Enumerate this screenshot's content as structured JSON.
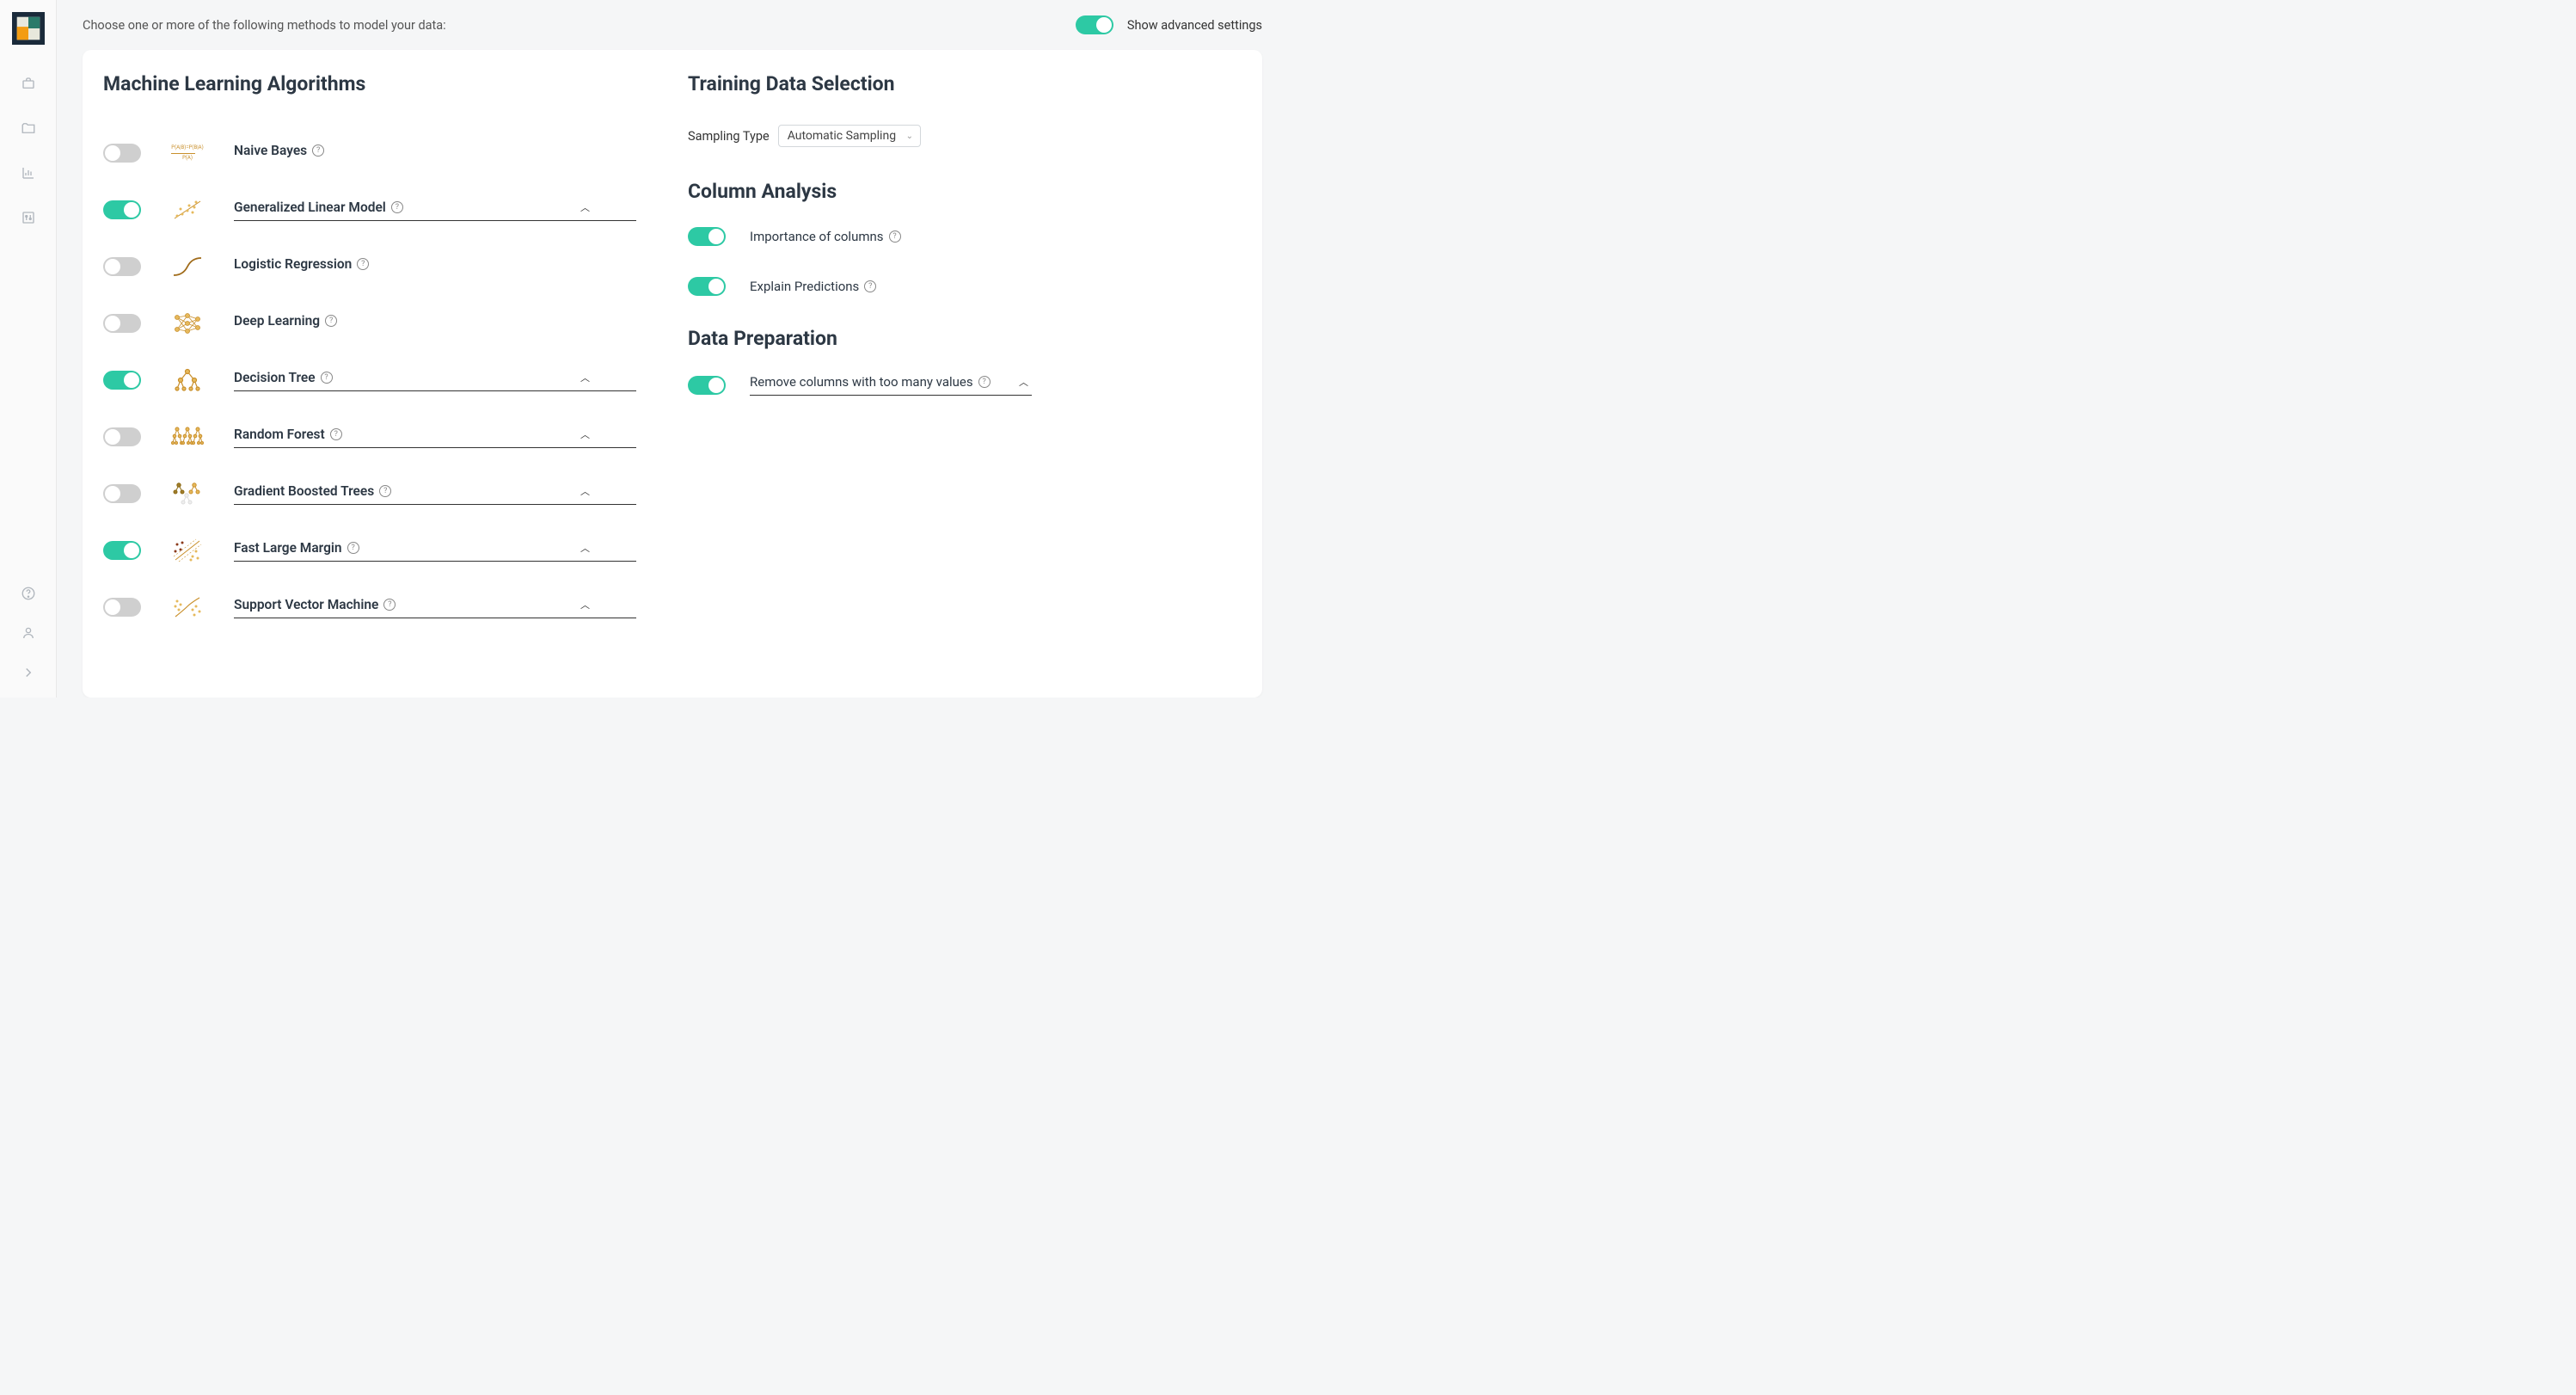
{
  "header": {
    "prompt": "Choose one or more of the following methods to model your data:",
    "advanced_label": "Show advanced settings",
    "advanced_on": true
  },
  "sections": {
    "algorithms_heading": "Machine Learning Algorithms",
    "training_heading": "Training Data Selection",
    "column_heading": "Column Analysis",
    "prep_heading": "Data Preparation"
  },
  "sampling": {
    "label": "Sampling Type",
    "value": "Automatic Sampling"
  },
  "column_analysis": {
    "importance_label": "Importance of columns",
    "importance_on": true,
    "explain_label": "Explain Predictions",
    "explain_on": true
  },
  "data_prep": {
    "remove_label": "Remove columns with too many values",
    "remove_on": true
  },
  "algorithms": [
    {
      "id": "naive-bayes",
      "label": "Naive Bayes",
      "on": false,
      "expandable": false
    },
    {
      "id": "glm",
      "label": "Generalized Linear Model",
      "on": true,
      "expandable": true
    },
    {
      "id": "logistic",
      "label": "Logistic Regression",
      "on": false,
      "expandable": false
    },
    {
      "id": "deep-learning",
      "label": "Deep Learning",
      "on": false,
      "expandable": false
    },
    {
      "id": "decision-tree",
      "label": "Decision Tree",
      "on": true,
      "expandable": true
    },
    {
      "id": "random-forest",
      "label": "Random Forest",
      "on": false,
      "expandable": true
    },
    {
      "id": "gbt",
      "label": "Gradient Boosted Trees",
      "on": false,
      "expandable": true
    },
    {
      "id": "flm",
      "label": "Fast Large Margin",
      "on": true,
      "expandable": true
    },
    {
      "id": "svm",
      "label": "Support Vector Machine",
      "on": false,
      "expandable": true
    }
  ]
}
